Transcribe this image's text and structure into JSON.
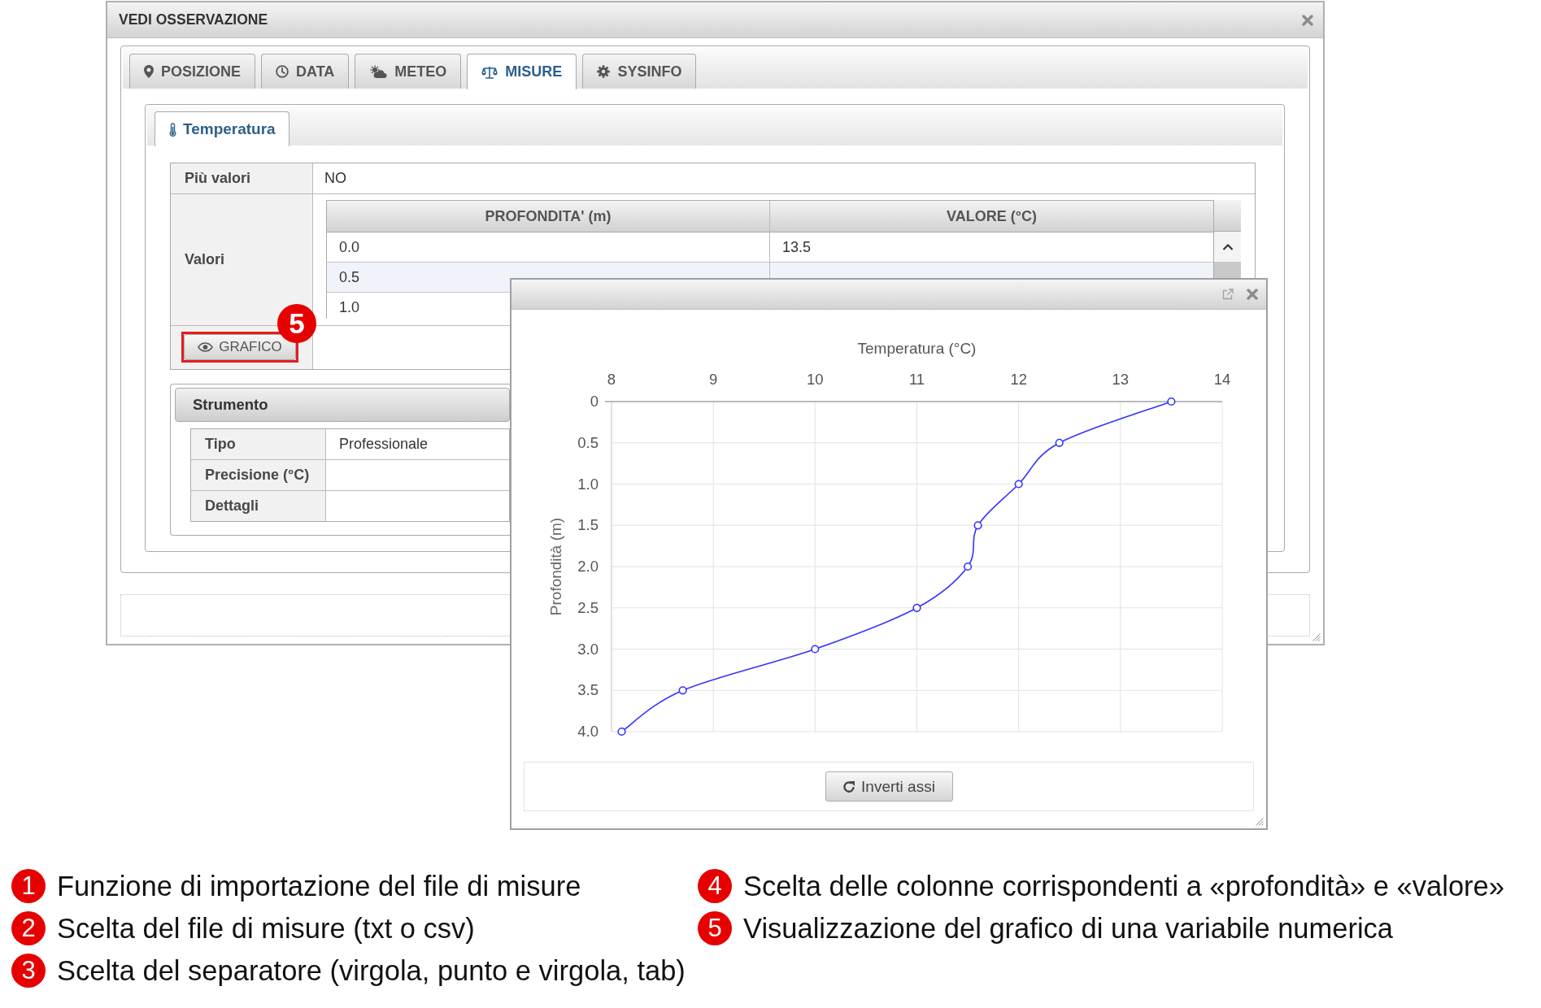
{
  "dialog": {
    "title": "VEDI OSSERVAZIONE",
    "tabs": [
      {
        "label": "POSIZIONE",
        "selected": false
      },
      {
        "label": "DATA",
        "selected": false
      },
      {
        "label": "METEO",
        "selected": false
      },
      {
        "label": "MISURE",
        "selected": true
      },
      {
        "label": "SYSINFO",
        "selected": false
      }
    ],
    "subtabs": [
      {
        "label": "Temperatura",
        "selected": true
      }
    ],
    "fields": [
      {
        "label": "Più valori",
        "value": "NO"
      }
    ],
    "values": {
      "label": "Valori",
      "columns": [
        "PROFONDITA' (m)",
        "VALORE (°C)"
      ],
      "rows": [
        {
          "cells": [
            "0.0",
            "13.5"
          ]
        },
        {
          "cells": [
            "0.5"
          ]
        },
        {
          "cells": [
            "1.0"
          ]
        }
      ]
    },
    "chart_button": {
      "label": "GRAFICO",
      "marker": "5"
    },
    "instrument": {
      "title": "Strumento",
      "fields": [
        {
          "label": "Tipo",
          "value": "Professionale"
        },
        {
          "label": "Precisione (°C)"
        },
        {
          "label": "Dettagli"
        }
      ]
    }
  },
  "chart_window": {
    "chart_data": {
      "type": "line",
      "xlabel": "Temperatura (°C)",
      "ylabel": "Profondità (m)",
      "x": [
        13.5,
        12.4,
        12.0,
        11.6,
        11.5,
        11.0,
        10.0,
        8.7,
        8.1
      ],
      "series": [
        {
          "color": "#3333ff",
          "marker": "circle",
          "values": [
            0,
            0.5,
            1.0,
            1.5,
            2.0,
            2.5,
            3.0,
            3.5,
            4.0
          ]
        }
      ],
      "xlim": [
        8,
        14
      ],
      "ylim": [
        4,
        0
      ],
      "xticks": [
        8,
        9,
        10,
        11,
        12,
        13,
        14
      ],
      "yticks": [
        0,
        0.5,
        {
          "value": 1,
          "label": "1.0"
        },
        1.5,
        {
          "value": 2,
          "label": "2.0"
        },
        2.5,
        {
          "value": 3,
          "label": "3.0"
        },
        3.5,
        {
          "value": 4,
          "label": "4.0"
        }
      ],
      "grid": true
    },
    "button": {
      "label": "Inverti assi"
    }
  },
  "legend": [
    {
      "number": "1",
      "text": "Funzione di importazione del file di misure"
    },
    {
      "number": "2",
      "text": "Scelta del file di misure (txt o csv)"
    },
    {
      "number": "3",
      "text": "Scelta del separatore (virgola, punto e virgola, tab)"
    },
    {
      "number": "4",
      "text": "Scelta delle colonne corrispondenti a «profondità» e «valore»"
    },
    {
      "number": "5",
      "text": "Visualizzazione del grafico di una variabile numerica"
    }
  ]
}
